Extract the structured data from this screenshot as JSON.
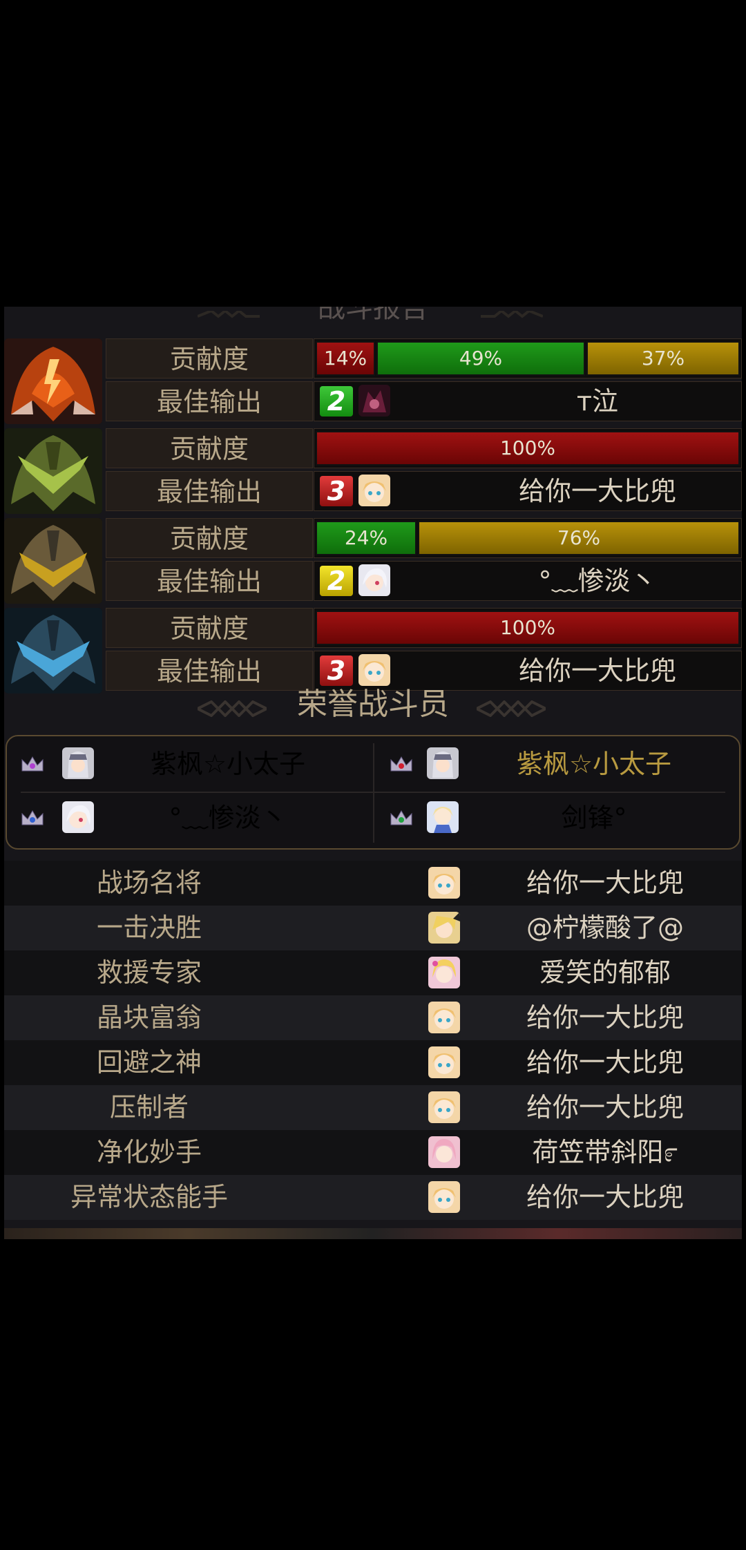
{
  "header": {
    "title": "战斗报告"
  },
  "teams": [
    {
      "icon": "red-knight-helmet-icon",
      "contrib_label": "贡献度",
      "best_label": "最佳输出",
      "bars": [
        {
          "label": "14%",
          "value": 14,
          "color": "red"
        },
        {
          "label": "49%",
          "value": 49,
          "color": "green"
        },
        {
          "label": "37%",
          "value": 37,
          "color": "gold"
        }
      ],
      "rank": "2",
      "rank_color": "green",
      "avatar": "dark-mage-avatar",
      "player": "ᴛ泣"
    },
    {
      "icon": "green-knight-helmet-icon",
      "contrib_label": "贡献度",
      "best_label": "最佳输出",
      "bars": [
        {
          "label": "100%",
          "value": 100,
          "color": "red"
        }
      ],
      "rank": "3",
      "rank_color": "red",
      "avatar": "blonde-girl-avatar",
      "player": "给你一大比兜"
    },
    {
      "icon": "gold-knight-helmet-icon",
      "contrib_label": "贡献度",
      "best_label": "最佳输出",
      "bars": [
        {
          "label": "24%",
          "value": 24,
          "color": "green"
        },
        {
          "label": "76%",
          "value": 76,
          "color": "gold"
        }
      ],
      "rank": "2",
      "rank_color": "yellow",
      "avatar": "white-hair-girl-avatar",
      "player": "°﹏惨淡丶"
    },
    {
      "icon": "blue-knight-helmet-icon",
      "contrib_label": "贡献度",
      "best_label": "最佳输出",
      "bars": [
        {
          "label": "100%",
          "value": 100,
          "color": "red"
        }
      ],
      "rank": "3",
      "rank_color": "red",
      "avatar": "blonde-girl-avatar",
      "player": "给你一大比兜"
    }
  ],
  "honor": {
    "title": "荣誉战斗员",
    "players": [
      {
        "name": "紫枫☆小太子",
        "crown": "purple-crown-icon",
        "color": "#dcd2c0"
      },
      {
        "name": "紫枫☆小太子",
        "crown": "red-crown-icon",
        "color": "#b89a40"
      },
      {
        "name": "°﹏惨淡丶",
        "crown": "blue-crown-icon",
        "color": "#dcd2c0"
      },
      {
        "name": "剑锋°",
        "crown": "green-crown-icon",
        "color": "#dcd2c0"
      }
    ]
  },
  "awards": [
    {
      "title": "战场名将",
      "player": "给你一大比兜"
    },
    {
      "title": "一击决胜",
      "player": "@柠檬酸了@"
    },
    {
      "title": "救援专家",
      "player": "爱笑的郁郁"
    },
    {
      "title": "晶块富翁",
      "player": "给你一大比兜"
    },
    {
      "title": "回避之神",
      "player": "给你一大比兜"
    },
    {
      "title": "压制者",
      "player": "给你一大比兜"
    },
    {
      "title": "净化妙手",
      "player": "荷笠带斜阳೯"
    },
    {
      "title": "异常状态能手",
      "player": "给你一大比兜"
    }
  ]
}
